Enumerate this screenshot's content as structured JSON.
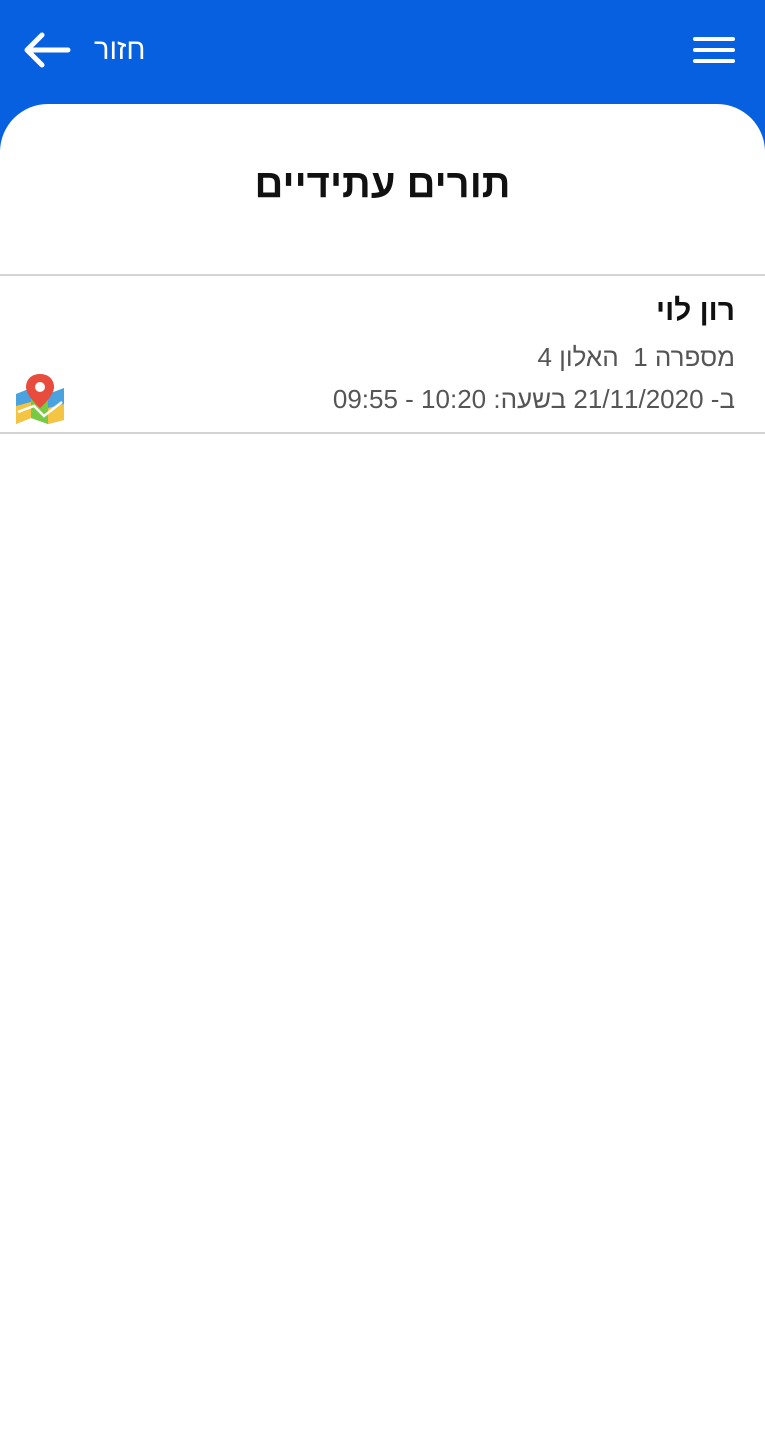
{
  "header": {
    "back_label": "חזור",
    "back_icon": "arrow-left-icon",
    "menu_icon": "hamburger-menu-icon",
    "background_color": "#0660e0"
  },
  "page": {
    "title": "תורים עתידיים"
  },
  "appointments": [
    {
      "name": "רון לוי",
      "address": "מספרה 1  האלון 4",
      "time": "ב- 21/11/2020 בשעה: 10:20 - 09:55",
      "map_icon": "map-location-icon"
    }
  ]
}
